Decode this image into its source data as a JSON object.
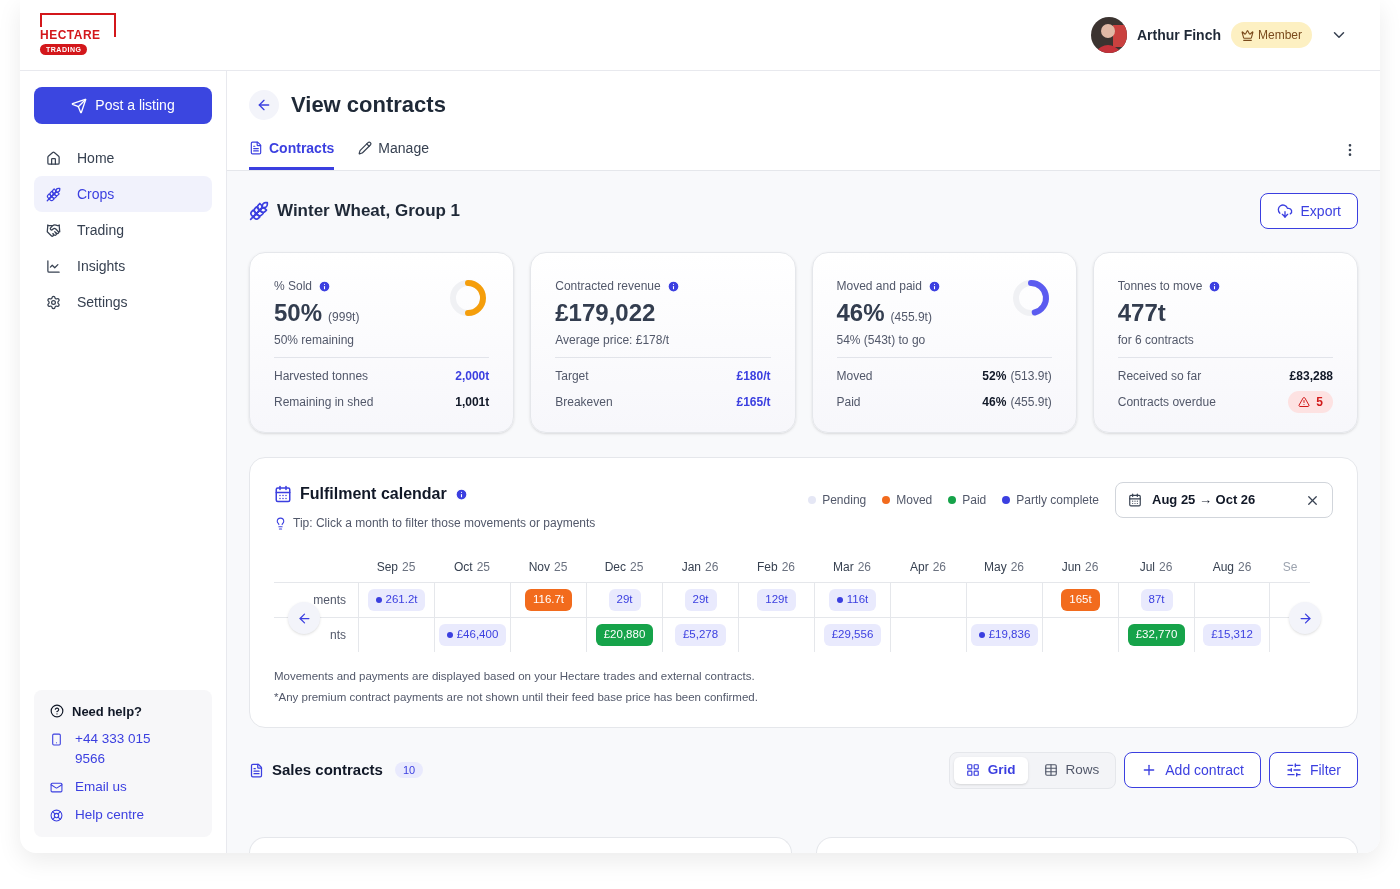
{
  "logo": {
    "word": "HECTARE",
    "tag": "TRADING"
  },
  "user": {
    "name": "Arthur Finch",
    "badge": "Member"
  },
  "sidebar": {
    "cta": "Post a listing",
    "items": [
      {
        "label": "Home",
        "selected": false
      },
      {
        "label": "Crops",
        "selected": true
      },
      {
        "label": "Trading",
        "selected": false
      },
      {
        "label": "Insights",
        "selected": false
      },
      {
        "label": "Settings",
        "selected": false
      }
    ],
    "help": {
      "title": "Need help?",
      "links": [
        {
          "label": "+44 333 015 9566"
        },
        {
          "label": "Email us"
        },
        {
          "label": "Help centre"
        }
      ]
    }
  },
  "page": {
    "title": "View contracts",
    "tabs": [
      {
        "label": "Contracts",
        "selected": true
      },
      {
        "label": "Manage",
        "selected": false
      }
    ]
  },
  "crop": {
    "title": "Winter Wheat, Group 1",
    "export": "Export"
  },
  "stats": [
    {
      "title": "% Sold",
      "value": "50%",
      "value_note": "(999t)",
      "sub": "50% remaining",
      "donut": {
        "level": 0.5,
        "color": "#f59e0b"
      },
      "rows": [
        {
          "label": "Harvested tonnes",
          "value": "2,000t",
          "kind": "link"
        },
        {
          "label": "Remaining in shed",
          "value": "1,001t",
          "kind": "strong"
        }
      ]
    },
    {
      "title": "Contracted revenue",
      "value": "£179,022",
      "sub": "Average price: £178/t",
      "rows": [
        {
          "label": "Target",
          "value": "£180/t",
          "kind": "link"
        },
        {
          "label": "Breakeven",
          "value": "£165/t",
          "kind": "link"
        }
      ]
    },
    {
      "title": "Moved and paid",
      "value": "46%",
      "value_note": "(455.9t)",
      "sub": "54% (543t) to go",
      "donut": {
        "level": 0.46,
        "color": "#5b5bf0"
      },
      "rows": [
        {
          "label": "Moved",
          "value": "52%",
          "note": "(513.9t)",
          "kind": "strong"
        },
        {
          "label": "Paid",
          "value": "46%",
          "note": "(455.9t)",
          "kind": "strong"
        }
      ]
    },
    {
      "title": "Tonnes to move",
      "value": "477t",
      "sub": "for 6 contracts",
      "rows": [
        {
          "label": "Received so far",
          "value": "£83,288",
          "kind": "strong"
        },
        {
          "label": "Contracts overdue",
          "value": "5",
          "kind": "alert"
        }
      ]
    }
  ],
  "calendar": {
    "title": "Fulfilment calendar",
    "tip": "Tip: Click a month to filter those movements or payments",
    "legend": [
      {
        "label": "Pending",
        "kind": "pending"
      },
      {
        "label": "Moved",
        "kind": "moved"
      },
      {
        "label": "Paid",
        "kind": "paid"
      },
      {
        "label": "Partly complete",
        "kind": "partly"
      }
    ],
    "range": "Aug 25 → Oct 26",
    "months": [
      {
        "month": "Sep",
        "year": "25"
      },
      {
        "month": "Oct",
        "year": "25"
      },
      {
        "month": "Nov",
        "year": "25"
      },
      {
        "month": "Dec",
        "year": "25"
      },
      {
        "month": "Jan",
        "year": "26"
      },
      {
        "month": "Feb",
        "year": "26"
      },
      {
        "month": "Mar",
        "year": "26"
      },
      {
        "month": "Apr",
        "year": "26"
      },
      {
        "month": "May",
        "year": "26"
      },
      {
        "month": "Jun",
        "year": "26"
      },
      {
        "month": "Jul",
        "year": "26"
      },
      {
        "month": "Aug",
        "year": "26"
      },
      {
        "month": "Se"
      }
    ],
    "rows": [
      {
        "label": "ments",
        "cells": [
          {
            "text": "261.2t",
            "kind": "partly"
          },
          null,
          {
            "text": "116.7t",
            "kind": "moved"
          },
          {
            "text": "29t",
            "kind": "pending"
          },
          {
            "text": "29t",
            "kind": "pending"
          },
          {
            "text": "129t",
            "kind": "pending"
          },
          {
            "text": "116t",
            "kind": "partly"
          },
          null,
          null,
          {
            "text": "165t",
            "kind": "moved"
          },
          {
            "text": "87t",
            "kind": "pending"
          },
          null
        ]
      },
      {
        "label": "nts",
        "cells": [
          null,
          {
            "text": "£46,400",
            "kind": "partly"
          },
          null,
          {
            "text": "£20,880",
            "kind": "paid"
          },
          {
            "text": "£5,278",
            "kind": "pending"
          },
          null,
          {
            "text": "£29,556",
            "kind": "pending"
          },
          null,
          {
            "text": "£19,836",
            "kind": "partly"
          },
          null,
          {
            "text": "£32,770",
            "kind": "paid"
          },
          {
            "text": "£15,312",
            "kind": "pending"
          }
        ]
      }
    ],
    "notes": [
      "Movements and payments are displayed based on your Hectare trades and external contracts.",
      "*Any premium contract payments are not shown until their feed base price has been confirmed."
    ]
  },
  "sales": {
    "title": "Sales contracts",
    "count": "10",
    "views": [
      {
        "label": "Grid",
        "selected": true
      },
      {
        "label": "Rows",
        "selected": false
      }
    ],
    "add": "Add contract",
    "filter": "Filter"
  }
}
